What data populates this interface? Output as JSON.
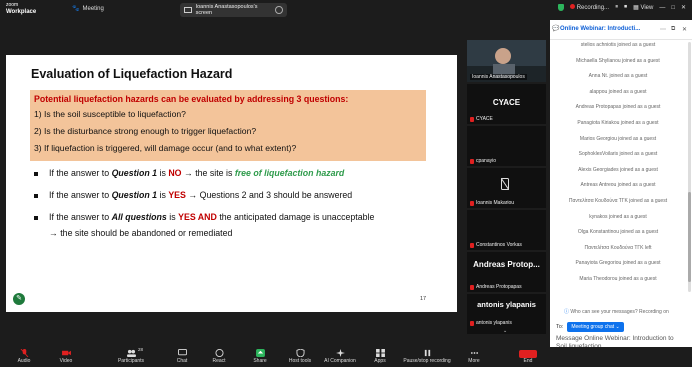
{
  "topbar": {
    "brand_line1": "zoom",
    "brand_line2": "Workplace",
    "meeting_label": "Meeting",
    "share_label": "Ioannis Anastasopoulos's screen",
    "recording_label": "Recording...",
    "view_label": "View"
  },
  "slide": {
    "title": "Evaluation of Liquefaction Hazard",
    "box_heading": "Potential liquefaction hazards can be evaluated by addressing 3 questions:",
    "questions": [
      "1)  Is the soil susceptible to liquefaction?",
      "2)  Is the disturbance strong enough to trigger liquefaction?",
      "3)  If liquefaction is triggered, will damage occur (and to what extent)?"
    ],
    "bullet1": {
      "pre": "If the answer to ",
      "q": "Question 1",
      "mid": " is ",
      "ans": "NO",
      "post": "  →  the site is ",
      "em": "free of liquefaction hazard"
    },
    "bullet2": {
      "pre": "If the answer to ",
      "q": "Question 1",
      "mid": " is ",
      "ans": "YES",
      "post": "  → Questions 2 and 3 should be answered"
    },
    "bullet3": {
      "pre": "If the answer to ",
      "q": "All questions",
      "mid": " is ",
      "ans": "YES",
      "and": "  AND",
      "post": "  the anticipated damage is unacceptable"
    },
    "bullet3_line2": "→ the site should be abandoned or remediated",
    "page_number": "17"
  },
  "tiles": [
    {
      "name": "Ioannis Anastasopoulos"
    },
    {
      "big": "CYACE",
      "name": "CYACE"
    },
    {
      "name": "cpanayio"
    },
    {
      "name": "Ioannis Makariou"
    },
    {
      "name": "Constantinos Vorkas"
    },
    {
      "big": "Andreas Protop...",
      "name": "Andreas Protopapas"
    },
    {
      "big": "antonis ylapanis",
      "name": "antonis ylapanis"
    }
  ],
  "chat": {
    "title": "Online Webinar: Introducti...",
    "messages": [
      "stelios achniotis joined as a guest",
      "Michaella Shylianou joined as a guest",
      "Anna Nt. joined as a guest",
      "alappou joined as a guest",
      "Andreas Protopapas joined as a guest",
      "Panagiota Kiriakou joined as a guest",
      "Marios Georgiou joined as a guest",
      "SophoklesVoilaris joined as a guest",
      "Alexis Georgiades joined as a guest",
      "Antreas Antreou joined as a guest",
      "Παντελίτσα Κουδούνα ΤΓΚ joined as a guest",
      "kynakos joined as a guest",
      "Olga Konstantinou joined as a guest",
      "Παντελίτσα Κουδούνα ΤΓΚ left",
      "Panayiota Gregoriou joined as a guest",
      "Maria Theodorou joined as a guest"
    ],
    "hint": "Who can see your messages? Recording on",
    "to_label": "To:",
    "to_value": "Meeting group chat",
    "compose": "Message Online Webinar: Introduction to Soil liquefaction"
  },
  "toolbar": {
    "items": [
      "Audio",
      "Video",
      "Participants",
      "Chat",
      "React",
      "Share",
      "Host tools",
      "AI Companion",
      "Apps",
      "Pause/stop recording",
      "More",
      "End"
    ],
    "participants_count": "28"
  },
  "colors": {
    "accent": "#0e72ed",
    "red": "#c00000",
    "green": "#2e9b4b",
    "box": "#f3c49a"
  }
}
